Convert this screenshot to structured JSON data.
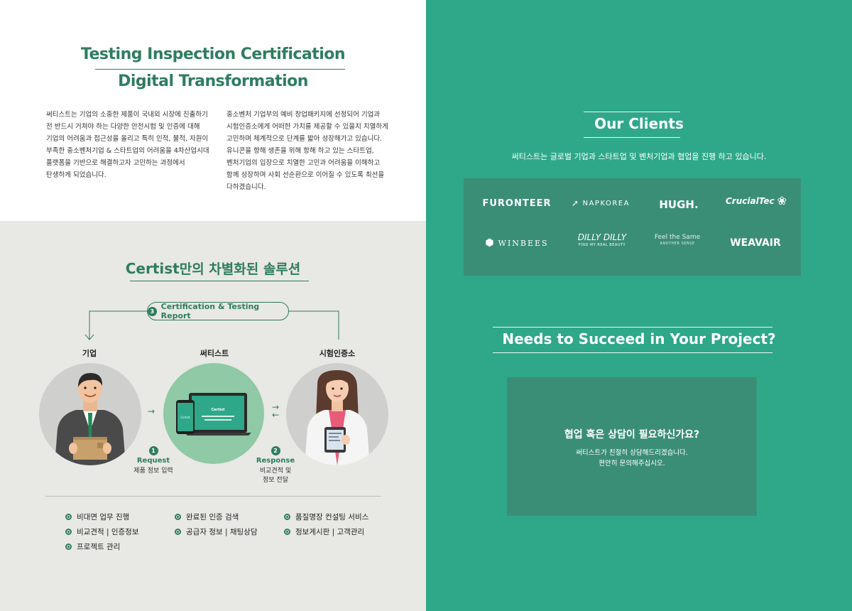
{
  "intro": {
    "title_line1": "Testing Inspection Certification",
    "title_line2": "Digital Transformation",
    "left_lines": [
      "써티스트는 기업의 소중한 제품이 국내외 시장에 진출하기",
      "전 반드시 거쳐야 하는 다양한 안전시험 및 인증에 대해",
      "기업의 어려움과 접근성을 올리고 특히 인적, 물적, 자원이",
      "부족한 중소벤처기업 & 스타트업의 어려움을 4차산업시대",
      "플랫폼을 기반으로 해결하고자 고민하는 과정에서",
      "탄생하게 되었습니다."
    ],
    "right_lines": [
      "중소벤처 기업부의 예비 창업패키지에 선정되어 기업과",
      "시험인증소에게 어떠한 가치를 제공할 수 있을지 치열하게",
      "고민하며 체계적으로 단계를 밟아 성장해가고 있습니다.",
      "유니콘을 향해 생존을 위해 항해 하고 있는 스타트업,",
      "벤처기업의 입장으로 치열한 고민과 어려움을 이해하고",
      "함께 성장하며 사회 선순환으로 이어질 수 있도록 최선을",
      "다하겠습니다."
    ]
  },
  "solution": {
    "title_brand": "Certist",
    "title_rest": "만의 차별화된 솔루션",
    "cert_step": "3",
    "cert_label": "Certification & Testing Report",
    "col_company": "기업",
    "col_certist": "써티스트",
    "col_agency": "시험인증소",
    "screen_brand": "Certist",
    "step1_num": "1",
    "step1_name": "Request",
    "step1_desc": "제품 정보 입력",
    "step2_num": "2",
    "step2_name": "Response",
    "step2_desc1": "비교견적 및",
    "step2_desc2": "정보 전달",
    "features": [
      "비대면 업무 진행",
      "완료된 인증 검색",
      "품질명장 컨설팅 서비스",
      "비교견적 | 인증정보",
      "공급자 정보 | 채팅상담",
      "정보게시판 | 고객관리",
      "프로젝트 관리"
    ]
  },
  "clients": {
    "title": "Our Clients",
    "subtitle": "써티스트는 글로벌 기업과 스타트업 및 벤처기업과 협업을 진행 하고 있습니다.",
    "logos": [
      "FURONTEER",
      "NAPKOREA",
      "HUGH.",
      "CrucialTec",
      "WINBEES",
      "DILLY DILLY",
      "Feel the Same",
      "WEAVAIR"
    ],
    "dilly_tagline": "FIND MY REAL BEAUTY",
    "feel_tagline": "ANOTHER SENSE"
  },
  "contact": {
    "title": "Needs to Succeed in Your Project?",
    "question": "협업 혹은 상담이 필요하신가요?",
    "desc1": "써티스트가 친절히 상담해드리겠습니다.",
    "desc2": "편안히 문의해주십시오."
  },
  "colors": {
    "brand_green": "#2e7d5f",
    "panel_green": "#2ea889",
    "box_green": "#3b8e76"
  }
}
